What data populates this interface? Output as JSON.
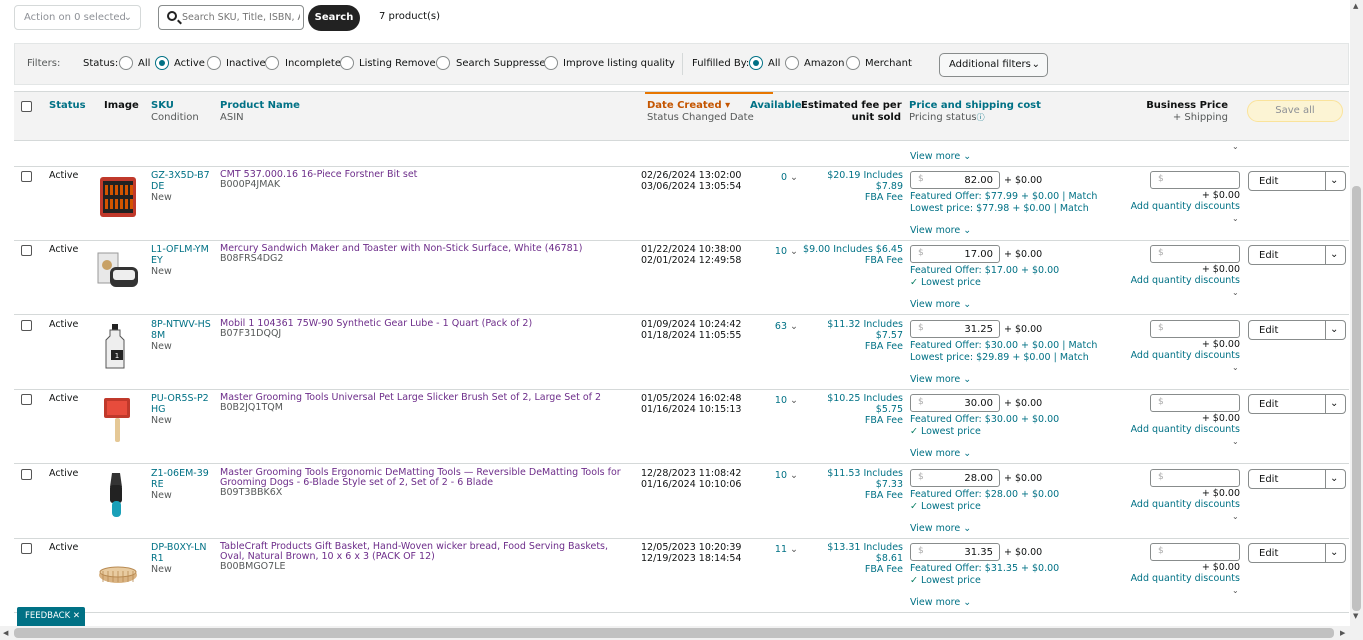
{
  "toolbar": {
    "action_label": "Action on 0 selected",
    "search_placeholder": "Search SKU, Title, ISBN, A",
    "search_button": "Search",
    "product_count": "7 product(s)"
  },
  "filters": {
    "label": "Filters:",
    "status_label": "Status:",
    "status_options": [
      "All",
      "Active",
      "Inactive",
      "Incomplete",
      "Listing Removed",
      "Search Suppressed",
      "Improve listing quality"
    ],
    "status_selected": "Active",
    "fulfilled_label": "Fulfilled By:",
    "fulfilled_options": [
      "All",
      "Amazon",
      "Merchant"
    ],
    "fulfilled_selected": "All",
    "additional_filters": "Additional filters"
  },
  "columns": {
    "status": "Status",
    "image": "Image",
    "sku": "SKU",
    "sku_sub": "Condition",
    "product_name": "Product Name",
    "product_sub": "ASIN",
    "date_created": "Date Created",
    "date_sub": "Status Changed Date",
    "available": "Available",
    "fee_line1": "Estimated fee per",
    "fee_line2": "unit sold",
    "price": "Price and shipping cost",
    "price_sub": "Pricing status",
    "business_price": "Business Price",
    "business_sub": "+ Shipping",
    "save_all": "Save all"
  },
  "view_more": "View more",
  "rows": [
    {
      "status": "Active",
      "sku": "GZ-3X5D-B7DE",
      "condition": "New",
      "title": "CMT 537.000.16 16-Piece Forstner Bit set",
      "asin": "B000P4JMAK",
      "date_created": "02/26/2024 13:02:00",
      "date_changed": "03/06/2024 13:05:54",
      "available": "0",
      "fee_line1": "$20.19 Includes $7.89",
      "fee_line2": "FBA Fee",
      "price": "82.00",
      "shipping": "+ $0.00",
      "offer": "Featured Offer: $77.99 + $0.00",
      "offer_match": "Match",
      "second_line": "Lowest price: $77.98 + $0.00",
      "second_match": "Match",
      "is_lowest": false,
      "bp_ship": "+ $0.00",
      "qty": "Add quantity discounts",
      "edit": "Edit"
    },
    {
      "status": "Active",
      "sku": "L1-OFLM-YMEY",
      "condition": "New",
      "title": "Mercury Sandwich Maker and Toaster with Non-Stick Surface, White (46781)",
      "asin": "B08FRS4DG2",
      "date_created": "01/22/2024 10:38:00",
      "date_changed": "02/01/2024 12:49:58",
      "available": "10",
      "fee_line1": "$9.00 Includes $6.45",
      "fee_line2": "FBA Fee",
      "price": "17.00",
      "shipping": "+ $0.00",
      "offer": "Featured Offer: $17.00 + $0.00",
      "offer_match": "",
      "second_line": "Lowest price",
      "second_match": "",
      "is_lowest": true,
      "bp_ship": "+ $0.00",
      "qty": "Add quantity discounts",
      "edit": "Edit"
    },
    {
      "status": "Active",
      "sku": "8P-NTWV-HS8M",
      "condition": "New",
      "title": "Mobil 1 104361 75W-90 Synthetic Gear Lube - 1 Quart (Pack of 2)",
      "asin": "B07F31DQQJ",
      "date_created": "01/09/2024 10:24:42",
      "date_changed": "01/18/2024 11:05:55",
      "available": "63",
      "fee_line1": "$11.32 Includes $7.57",
      "fee_line2": "FBA Fee",
      "price": "31.25",
      "shipping": "+ $0.00",
      "offer": "Featured Offer: $30.00 + $0.00",
      "offer_match": "Match",
      "second_line": "Lowest price: $29.89 + $0.00",
      "second_match": "Match",
      "is_lowest": false,
      "bp_ship": "+ $0.00",
      "qty": "Add quantity discounts",
      "edit": "Edit"
    },
    {
      "status": "Active",
      "sku": "PU-OR5S-P2HG",
      "condition": "New",
      "title": "Master Grooming Tools Universal Pet Large Slicker Brush Set of 2, Large Set of 2",
      "asin": "B0B2JQ1TQM",
      "date_created": "01/05/2024 16:02:48",
      "date_changed": "01/16/2024 10:15:13",
      "available": "10",
      "fee_line1": "$10.25 Includes $5.75",
      "fee_line2": "FBA Fee",
      "price": "30.00",
      "shipping": "+ $0.00",
      "offer": "Featured Offer: $30.00 + $0.00",
      "offer_match": "",
      "second_line": "Lowest price",
      "second_match": "",
      "is_lowest": true,
      "bp_ship": "+ $0.00",
      "qty": "Add quantity discounts",
      "edit": "Edit"
    },
    {
      "status": "Active",
      "sku": "Z1-06EM-39RE",
      "condition": "New",
      "title": "Master Grooming Tools Ergonomic DeMatting Tools — Reversible DeMatting Tools for Grooming Dogs - 6-Blade Style set of 2, Set of 2 - 6 Blade",
      "asin": "B09T3BBK6X",
      "date_created": "12/28/2023 11:08:42",
      "date_changed": "01/16/2024 10:10:06",
      "available": "10",
      "fee_line1": "$11.53 Includes $7.33",
      "fee_line2": "FBA Fee",
      "price": "28.00",
      "shipping": "+ $0.00",
      "offer": "Featured Offer: $28.00 + $0.00",
      "offer_match": "",
      "second_line": "Lowest price",
      "second_match": "",
      "is_lowest": true,
      "bp_ship": "+ $0.00",
      "qty": "Add quantity discounts",
      "edit": "Edit"
    },
    {
      "status": "Active",
      "sku": "DP-B0XY-LNR1",
      "condition": "New",
      "title": "TableCraft Products Gift Basket, Hand-Woven wicker bread, Food Serving Baskets, Oval, Natural Brown, 10 x 6 x 3 (PACK OF 12)",
      "asin": "B00BMGO7LE",
      "date_created": "12/05/2023 10:20:39",
      "date_changed": "12/19/2023 18:14:54",
      "available": "11",
      "fee_line1": "$13.31 Includes $8.61",
      "fee_line2": "FBA Fee",
      "price": "31.35",
      "shipping": "+ $0.00",
      "offer": "Featured Offer: $31.35 + $0.00",
      "offer_match": "",
      "second_line": "Lowest price",
      "second_match": "",
      "is_lowest": true,
      "bp_ship": "+ $0.00",
      "qty": "Add quantity discounts",
      "edit": "Edit"
    }
  ],
  "currency_symbol": "$",
  "feedback": "FEEDBACK"
}
